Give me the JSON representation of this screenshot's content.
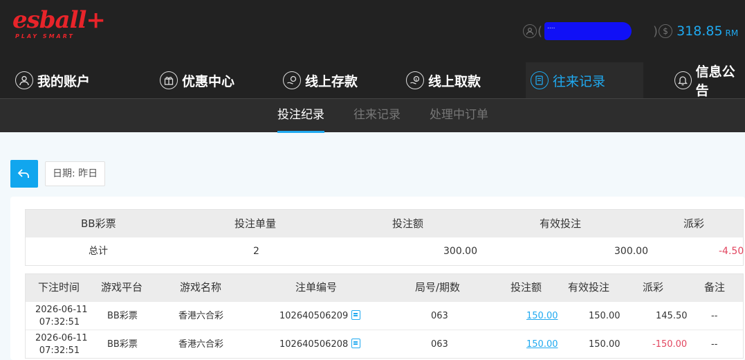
{
  "header": {
    "logo_text": "esball+",
    "logo_tagline": "PLAY SMART",
    "username_masked": "....",
    "balance": "318.85",
    "balance_unit": "RM"
  },
  "main_nav": [
    {
      "label": "我的账户",
      "icon": "user-icon"
    },
    {
      "label": "优惠中心",
      "icon": "gift-icon"
    },
    {
      "label": "线上存款",
      "icon": "deposit-icon"
    },
    {
      "label": "线上取款",
      "icon": "withdraw-icon"
    },
    {
      "label": "往来记录",
      "icon": "records-icon",
      "active": true
    },
    {
      "label": "信息公告",
      "icon": "bell-icon"
    }
  ],
  "sub_tabs": [
    {
      "label": "投注纪录",
      "active": true
    },
    {
      "label": "往来记录"
    },
    {
      "label": "处理中订单"
    }
  ],
  "toolbar": {
    "date_label": "日期: 昨日"
  },
  "summary": {
    "headers": [
      "BB彩票",
      "投注单量",
      "投注额",
      "有效投注",
      "派彩"
    ],
    "total_row": [
      "总计",
      "2",
      "300.00",
      "300.00",
      "-4.50"
    ]
  },
  "details": {
    "headers": [
      "下注时间",
      "游戏平台",
      "游戏名称",
      "注单编号",
      "局号/期数",
      "投注额",
      "有效投注",
      "派彩",
      "备注"
    ],
    "rows": [
      {
        "date": "2026-06-11",
        "time": "07:32:51",
        "platform": "BB彩票",
        "game": "香港六合彩",
        "bet_id": "102640506209",
        "round": "063",
        "bet": "150.00",
        "valid": "150.00",
        "payout": "145.50",
        "note": "--"
      },
      {
        "date": "2026-06-11",
        "time": "07:32:51",
        "platform": "BB彩票",
        "game": "香港六合彩",
        "bet_id": "102640506208",
        "round": "063",
        "bet": "150.00",
        "valid": "150.00",
        "payout": "-150.00",
        "note": "--"
      }
    ]
  },
  "colors": {
    "accent": "#1fa9f0",
    "negative": "#e2455f",
    "brand": "#e8242a",
    "header_bg": "#222222"
  }
}
